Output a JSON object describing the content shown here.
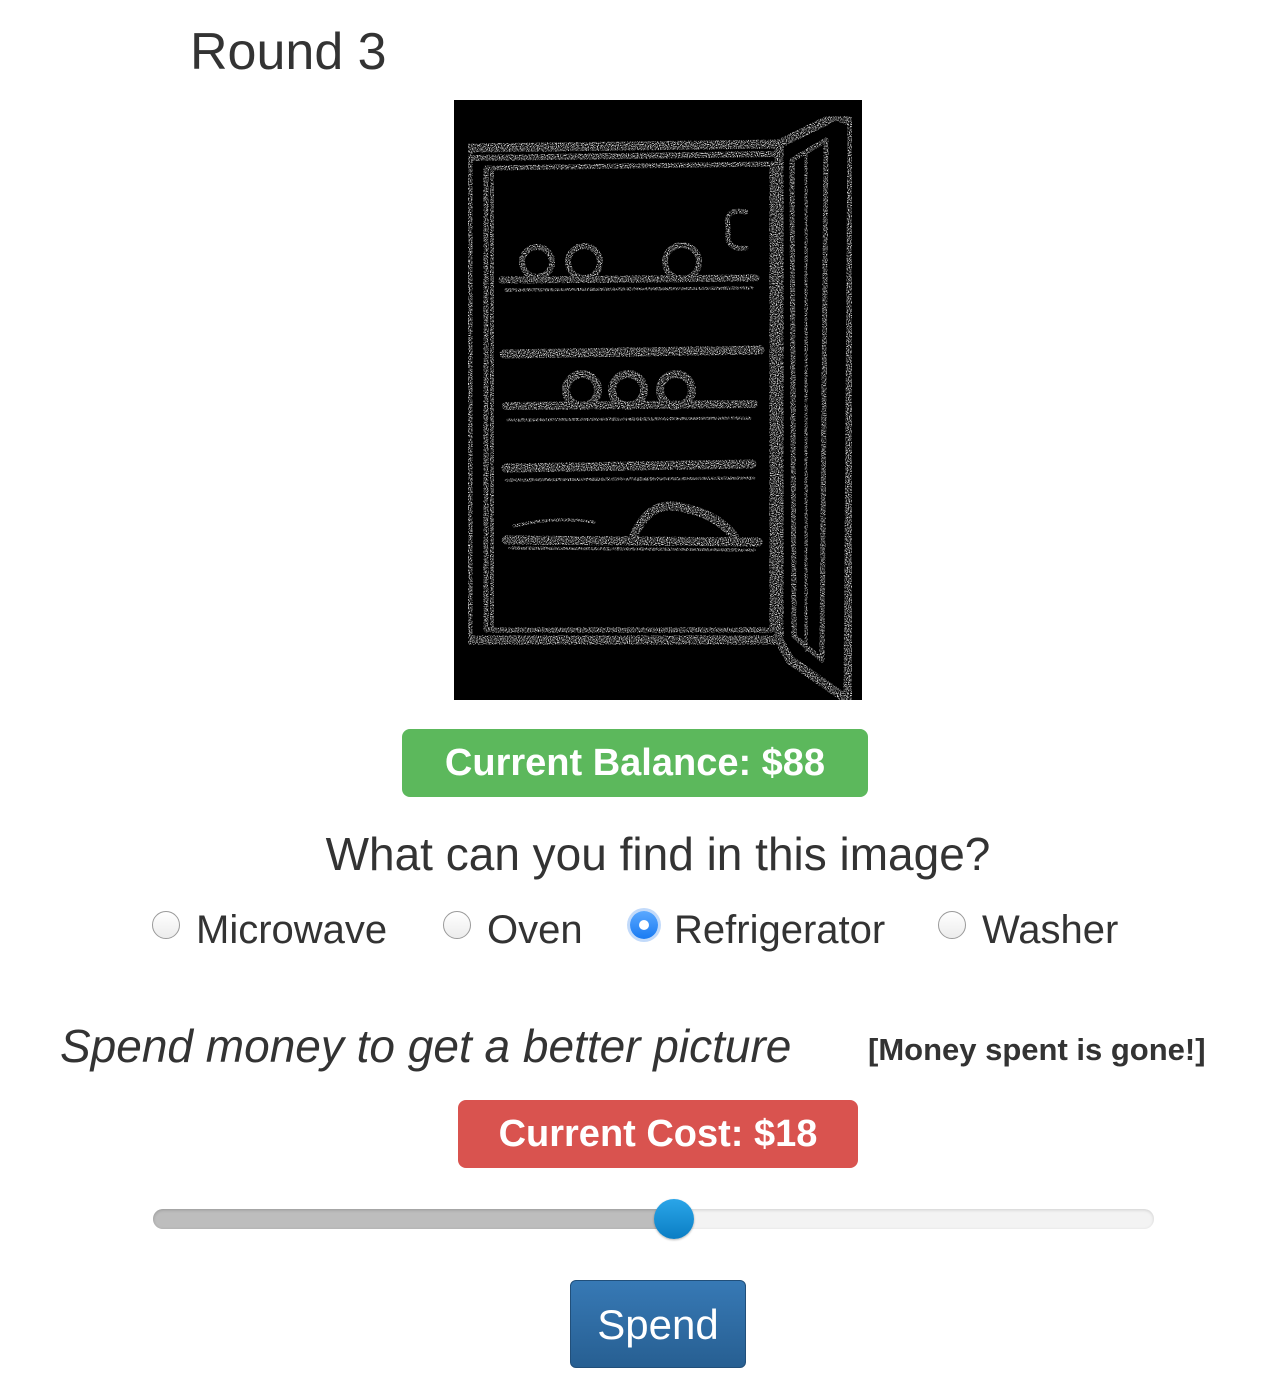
{
  "round": {
    "title": "Round 3"
  },
  "image": {
    "subject": "refrigerator-edge-map",
    "background": "#000000"
  },
  "balance": {
    "label": "Current Balance: $88",
    "color": "#5cb85c"
  },
  "question": {
    "prompt": "What can you find in this image?",
    "options": [
      {
        "label": "Microwave",
        "checked": false
      },
      {
        "label": "Oven",
        "checked": false
      },
      {
        "label": "Refrigerator",
        "checked": true
      },
      {
        "label": "Washer",
        "checked": false
      }
    ]
  },
  "spend": {
    "prompt": "Spend money to get a better picture",
    "note": "[Money spent is gone!]",
    "cost_label": "Current Cost: $18",
    "cost_color": "#d9534f",
    "slider_fraction": 0.52,
    "button_label": "Spend"
  }
}
